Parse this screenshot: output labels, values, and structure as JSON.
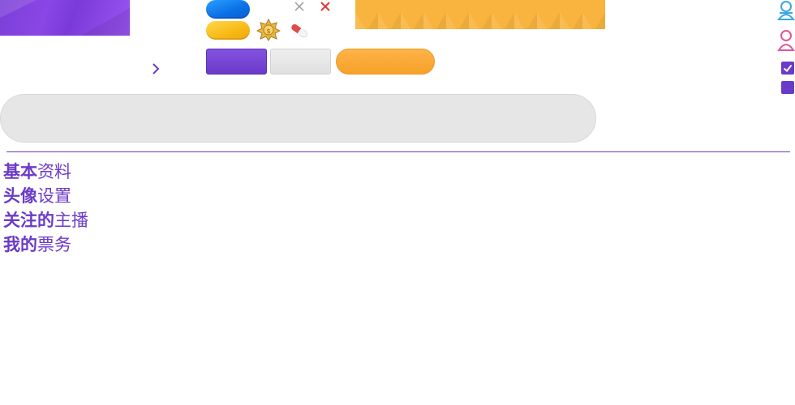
{
  "menu": {
    "items": [
      {
        "strong": "基本",
        "rest": "资料"
      },
      {
        "strong": "头像",
        "rest": "设置"
      },
      {
        "strong": "关注的",
        "rest": "主播"
      },
      {
        "strong": "我的",
        "rest": "票务"
      }
    ]
  },
  "colors": {
    "accent": "#6a3bc8",
    "orange": "#f8b43e",
    "blue": "#0a6fe6",
    "yellow": "#f7b916",
    "red": "#e03a3a",
    "input_bg": "#e6e6e6"
  },
  "icons": {
    "chevron": "chevron-right-icon",
    "close_gray": "close-icon",
    "close_red": "close-icon",
    "coin": "gear-coin-icon",
    "capsule": "capsule-icon",
    "user_blue": "user-icon",
    "user_pink": "user-icon",
    "checkbox": "checkbox-checked-icon",
    "checkbox_empty": "checkbox-icon"
  }
}
